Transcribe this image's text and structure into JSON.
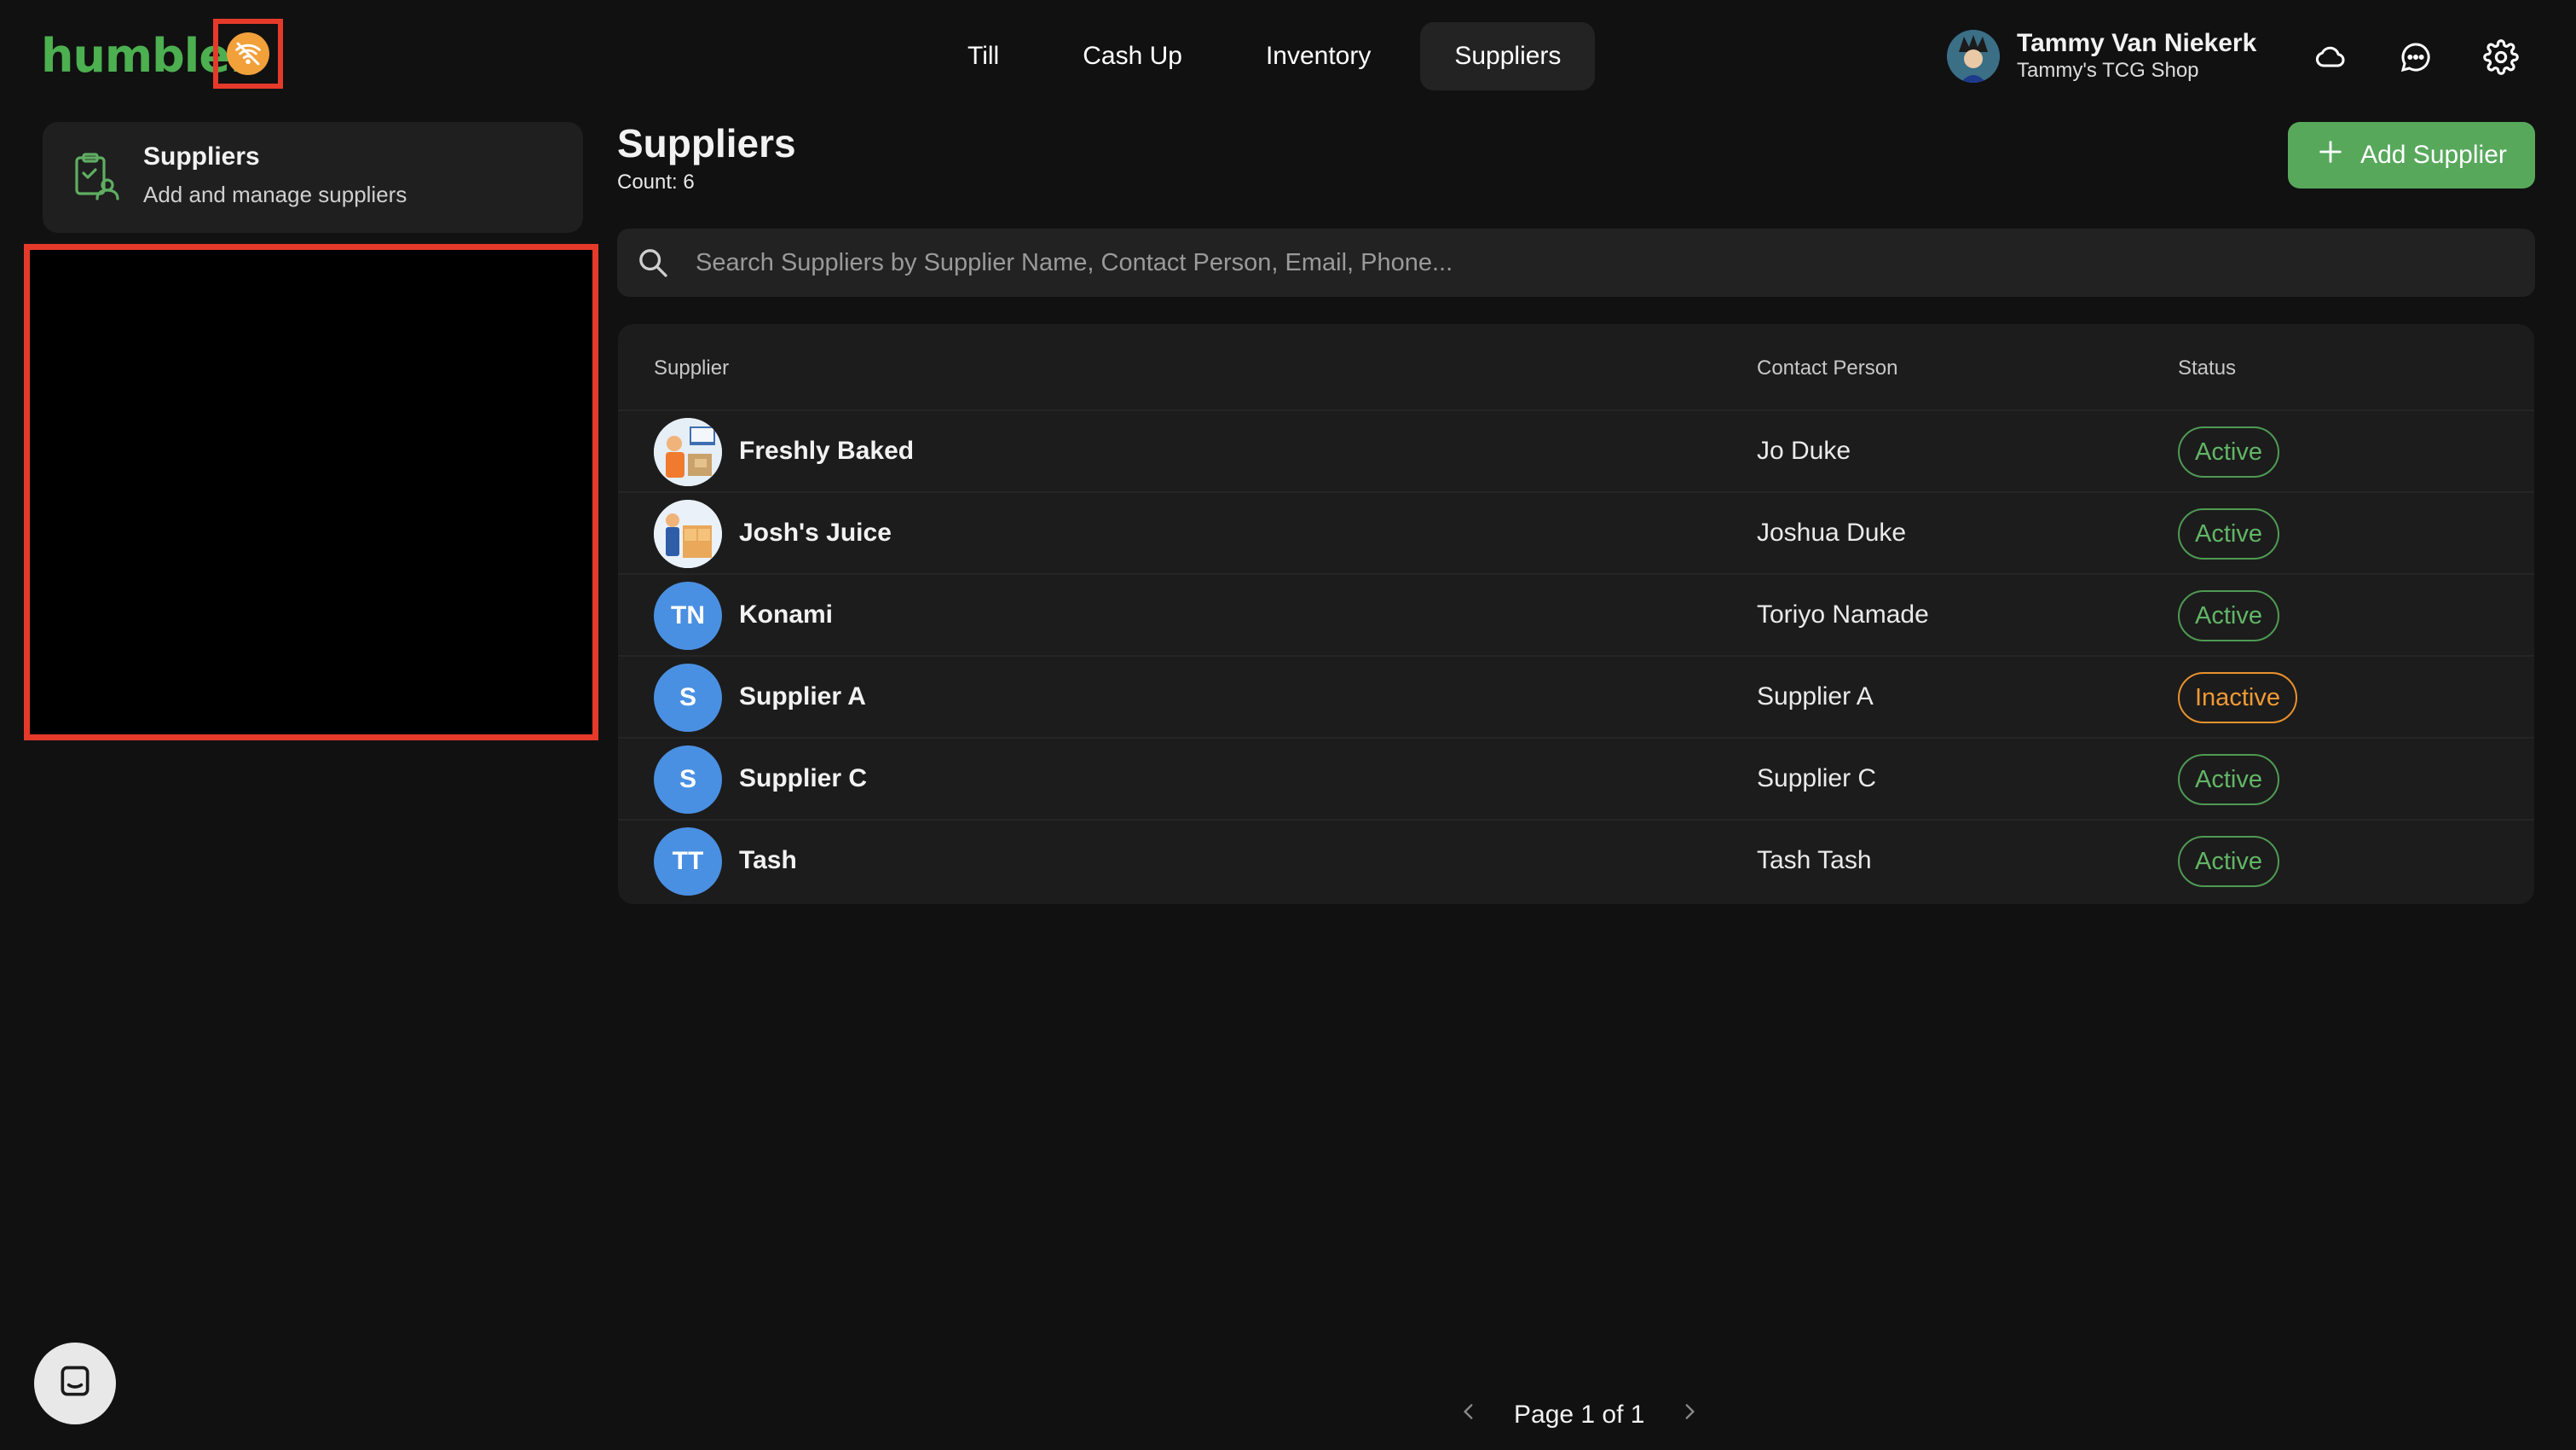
{
  "header": {
    "logo_text": "humble.",
    "nav": [
      {
        "label": "Till",
        "active": false
      },
      {
        "label": "Cash Up",
        "active": false
      },
      {
        "label": "Inventory",
        "active": false
      },
      {
        "label": "Suppliers",
        "active": true
      }
    ],
    "user": {
      "name": "Tammy Van Niekerk",
      "shop": "Tammy's TCG Shop"
    },
    "icons": [
      "cloud-icon",
      "chat-bubble-icon",
      "gear-icon"
    ]
  },
  "sidebar": {
    "card_title": "Suppliers",
    "card_subtitle": "Add and manage suppliers"
  },
  "main": {
    "title": "Suppliers",
    "count": "Count: 6",
    "add_button": "Add Supplier",
    "search_placeholder": "Search Suppliers by Supplier Name, Contact Person, Email, Phone...",
    "columns": [
      "Supplier",
      "Contact Person",
      "Status"
    ],
    "rows": [
      {
        "avatar": "",
        "avatar_type": "image",
        "name": "Freshly Baked",
        "contact": "Jo Duke",
        "status": "Active"
      },
      {
        "avatar": "",
        "avatar_type": "image",
        "name": "Josh's Juice",
        "contact": "Joshua Duke",
        "status": "Active"
      },
      {
        "avatar": "TN",
        "avatar_type": "initials",
        "name": "Konami",
        "contact": "Toriyo Namade",
        "status": "Active"
      },
      {
        "avatar": "S",
        "avatar_type": "initials",
        "name": "Supplier A",
        "contact": "Supplier A",
        "status": "Inactive"
      },
      {
        "avatar": "S",
        "avatar_type": "initials",
        "name": "Supplier C",
        "contact": "Supplier C",
        "status": "Active"
      },
      {
        "avatar": "TT",
        "avatar_type": "initials",
        "name": "Tash",
        "contact": "Tash Tash",
        "status": "Active"
      }
    ],
    "pager": "Page 1 of 1"
  },
  "colors": {
    "accent": "#58a85c",
    "active_badge": "#62b566",
    "inactive_badge": "#f09a35",
    "highlight": "#e53a2a"
  }
}
